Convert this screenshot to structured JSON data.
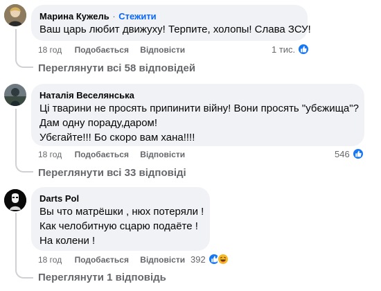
{
  "comments": [
    {
      "author": "Марина Кужель",
      "follow_label": "Стежити",
      "separator": "·",
      "lines": [
        "Ваш царь любит движуху! Терпите, холопы! Слава ЗСУ!"
      ],
      "time": "18 год",
      "like_label": "Подобається",
      "reply_label": "Відповісти",
      "reaction_count": "1 тис.",
      "reactions": [
        "like-icon"
      ],
      "view_replies": "Переглянути всі 58 відповідей"
    },
    {
      "author": "Наталія Веселянська",
      "lines": [
        "Ці тварини не просять припинити війну! Вони просять \"убєжища\"?",
        "Дам одну пораду,даром!",
        "Убєгайте!!! Бо скоро вам хана!!!!"
      ],
      "time": "18 год",
      "like_label": "Подобається",
      "reply_label": "Відповісти",
      "reaction_count": "546",
      "reactions": [
        "like-icon"
      ],
      "view_replies": "Переглянути всі 33 відповіді"
    },
    {
      "author": "Darts Pol",
      "lines": [
        "Вы что матрёшки , нюх потеряли !",
        "Как челобитную сцарю подаёте !",
        "На колени !"
      ],
      "time": "18 год",
      "like_label": "Подобається",
      "reply_label": "Відповісти",
      "reaction_count": "392",
      "reactions": [
        "like-icon",
        "haha-icon"
      ],
      "view_replies": "Переглянути 1 відповідь"
    }
  ],
  "colors": {
    "bubble": "#f0f2f5",
    "meta_text": "#65676b",
    "follow": "#0866ff",
    "like": "#1877f2",
    "haha": "#f7b928",
    "thread_line": "#ced0d4"
  }
}
